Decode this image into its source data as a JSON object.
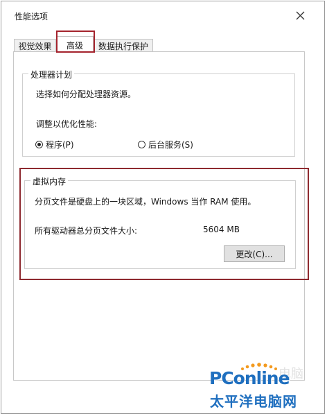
{
  "window": {
    "title": "性能选项"
  },
  "tabs": [
    {
      "label": "视觉效果"
    },
    {
      "label": "高级",
      "active": true
    },
    {
      "label": "数据执行保护"
    }
  ],
  "processor": {
    "legend": "处理器计划",
    "description": "选择如何分配处理器资源。",
    "optimize_label": "调整以优化性能:",
    "options": [
      {
        "label": "程序(P)",
        "selected": true
      },
      {
        "label": "后台服务(S)",
        "selected": false
      }
    ]
  },
  "virtual_memory": {
    "legend": "虚拟内存",
    "description": "分页文件是硬盘上的一块区域，Windows 当作 RAM 使用。",
    "total_label": "所有驱动器总分页文件大小:",
    "total_value": "5604 MB",
    "change_button": "更改(C)..."
  },
  "watermark": {
    "brand": "PConline",
    "cn": "太平洋电脑网",
    "ghost": "电脑"
  },
  "colors": {
    "highlight": "#a4232d",
    "brand_blue": "#1f6fbf",
    "brand_orange": "#f39a1e"
  }
}
